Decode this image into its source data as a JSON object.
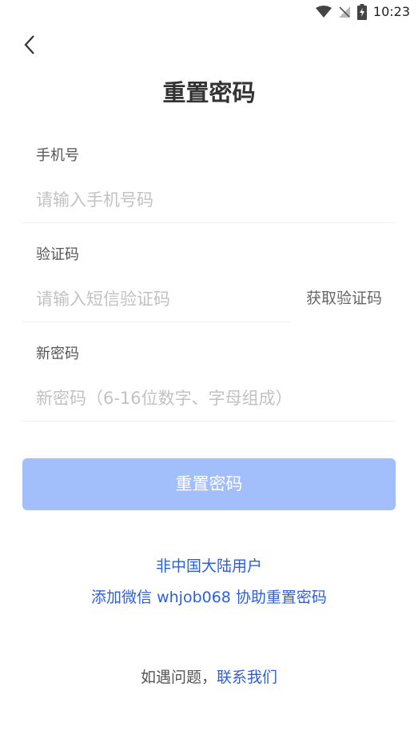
{
  "status_bar": {
    "time": "10:23",
    "icons": [
      "wifi-icon",
      "no-signal-icon",
      "battery-charging-icon"
    ]
  },
  "header": {
    "back_icon": "chevron-left-icon",
    "title": "重置密码"
  },
  "form": {
    "phone": {
      "label": "手机号",
      "placeholder": "请输入手机号码",
      "value": ""
    },
    "code": {
      "label": "验证码",
      "placeholder": "请输入短信验证码",
      "value": "",
      "get_code_label": "获取验证码"
    },
    "password": {
      "label": "新密码",
      "placeholder": "新密码（6-16位数字、字母组成）",
      "value": ""
    },
    "submit_label": "重置密码"
  },
  "intl": {
    "line1": "非中国大陆用户",
    "line2": "添加微信 whjob068 协助重置密码"
  },
  "help": {
    "text": "如遇问题，",
    "link": "联系我们"
  },
  "colors": {
    "accent": "#2d5fdc",
    "button_disabled": "#a3bffb",
    "placeholder": "#c2c2c2",
    "divider": "#eeeeee"
  }
}
